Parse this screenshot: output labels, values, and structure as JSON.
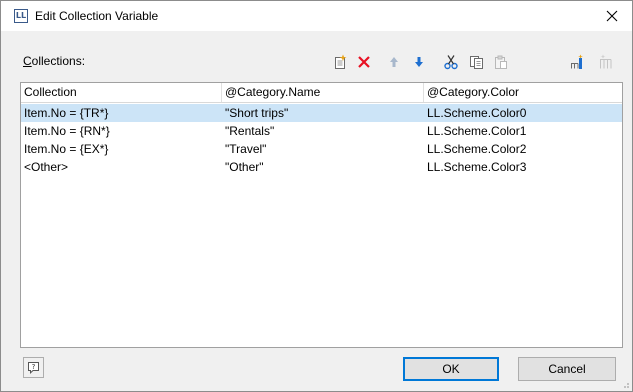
{
  "window": {
    "app_icon_text": "LL",
    "title": "Edit Collection Variable",
    "close_glyph": "✕"
  },
  "section": {
    "label_accel": "C",
    "label_rest": "ollections:"
  },
  "toolbar": {
    "icons": [
      "new-item-icon",
      "delete-icon",
      "move-up-icon",
      "move-down-icon",
      "cut-icon",
      "copy-icon",
      "paste-icon",
      "insert-icon",
      "insert-disabled-icon"
    ]
  },
  "table": {
    "columns": [
      "Collection",
      "@Category.Name",
      "@Category.Color"
    ],
    "rows": [
      [
        "Item.No = {TR*}",
        "\"Short trips\"",
        "LL.Scheme.Color0"
      ],
      [
        "Item.No = {RN*}",
        "\"Rentals\"",
        "LL.Scheme.Color1"
      ],
      [
        "Item.No = {EX*}",
        "\"Travel\"",
        "LL.Scheme.Color2"
      ],
      [
        "<Other>",
        "\"Other\"",
        "LL.Scheme.Color3"
      ]
    ],
    "selected_row": 0
  },
  "buttons": {
    "ok": "OK",
    "cancel": "Cancel",
    "help_glyph": "?"
  },
  "colors": {
    "selection": "#cce4f7",
    "delete_red": "#e81123",
    "arrow_blue": "#1e6fd0",
    "default_border": "#0078d7"
  }
}
